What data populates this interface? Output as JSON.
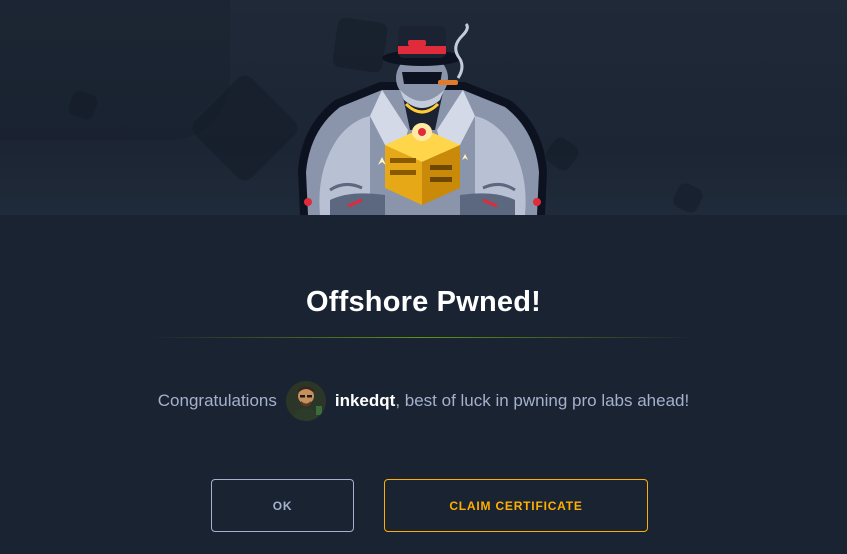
{
  "dialog": {
    "title": "Offshore Pwned!",
    "message_prefix": "Congratulations",
    "username": "inkedqt",
    "message_suffix": ", best of luck in pwning pro labs ahead!"
  },
  "buttons": {
    "ok_label": "OK",
    "claim_label": "CLAIM CERTIFICATE"
  },
  "icons": {
    "mascot": "mobster-mascot-icon",
    "avatar": "user-avatar"
  },
  "colors": {
    "background": "#1a2332",
    "accent_green": "#9fef00",
    "accent_orange": "#ffaf00",
    "muted_text": "#a4b1cd"
  }
}
